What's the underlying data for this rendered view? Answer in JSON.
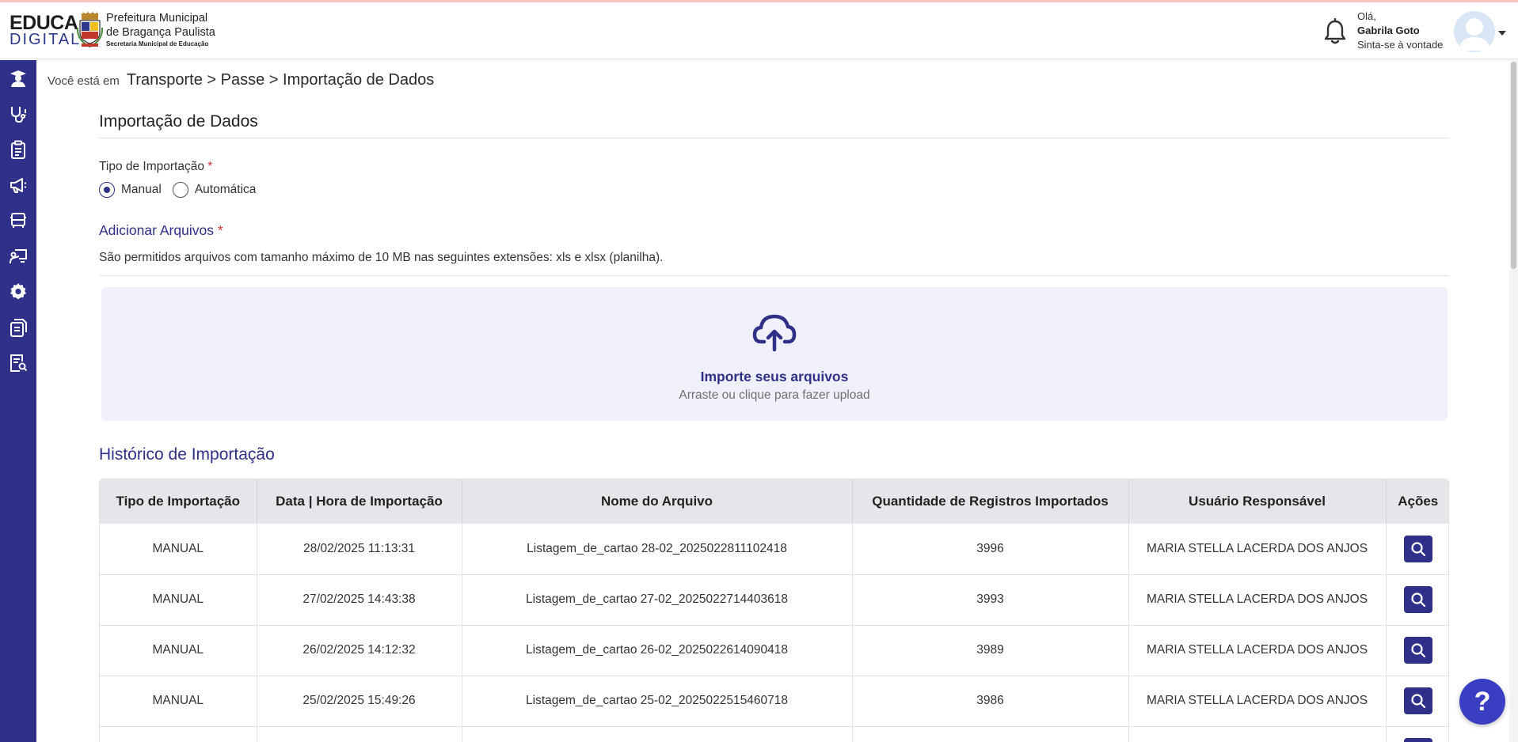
{
  "header": {
    "brand_top": "EDUCA",
    "brand_bottom": "DIGITAL",
    "prefecture_line1": "Prefeitura Municipal",
    "prefecture_line2": "de Bragança Paulista",
    "prefecture_line3": "Secretaria Municipal de Educação",
    "greeting": "Olá,",
    "user_name": "Gabrila Goto",
    "user_subtitle": "Sinta-se à vontade"
  },
  "sidebar": {
    "items": [
      {
        "icon": "graduate-icon"
      },
      {
        "icon": "stethoscope-icon"
      },
      {
        "icon": "clipboard-icon"
      },
      {
        "icon": "megaphone-icon"
      },
      {
        "icon": "bus-icon"
      },
      {
        "icon": "teacher-board-icon"
      },
      {
        "icon": "gear-icon"
      },
      {
        "icon": "documents-icon"
      },
      {
        "icon": "report-search-icon"
      }
    ]
  },
  "breadcrumb": {
    "prefix": "Você está em",
    "path": "Transporte > Passe > Importação de Dados"
  },
  "page": {
    "title": "Importação de Dados",
    "import_type_label": "Tipo de Importação",
    "required_mark": "*",
    "options": [
      "Manual",
      "Automática"
    ],
    "selected_option": "Manual",
    "add_files_label": "Adicionar Arquivos",
    "info_text": "São permitidos arquivos com tamanho máximo de 10 MB nas seguintes extensões: xls e xlsx (planilha).",
    "dropzone_title": "Importe seus arquivos",
    "dropzone_subtitle": "Arraste ou clique para fazer upload"
  },
  "history": {
    "title": "Histórico de Importação",
    "columns": [
      "Tipo de Importação",
      "Data | Hora de Importação",
      "Nome do Arquivo",
      "Quantidade de Registros Importados",
      "Usuário Responsável",
      "Ações"
    ],
    "rows": [
      {
        "type": "MANUAL",
        "datetime": "28/02/2025 11:13:31",
        "file": "Listagem_de_cartao 28-02_2025022811102418",
        "count": "3996",
        "user": "MARIA STELLA LACERDA DOS ANJOS"
      },
      {
        "type": "MANUAL",
        "datetime": "27/02/2025 14:43:38",
        "file": "Listagem_de_cartao 27-02_2025022714403618",
        "count": "3993",
        "user": "MARIA STELLA LACERDA DOS ANJOS"
      },
      {
        "type": "MANUAL",
        "datetime": "26/02/2025 14:12:32",
        "file": "Listagem_de_cartao 26-02_2025022614090418",
        "count": "3989",
        "user": "MARIA STELLA LACERDA DOS ANJOS"
      },
      {
        "type": "MANUAL",
        "datetime": "25/02/2025 15:49:26",
        "file": "Listagem_de_cartao 25-02_2025022515460718",
        "count": "3986",
        "user": "MARIA STELLA LACERDA DOS ANJOS"
      },
      {
        "type": "",
        "datetime": "",
        "file": "",
        "count": "",
        "user": ""
      }
    ]
  },
  "help": {
    "label": "?"
  },
  "colors": {
    "primary": "#2e3187",
    "required": "#d32f2f",
    "dropzone_bg": "#f0f0fb"
  }
}
